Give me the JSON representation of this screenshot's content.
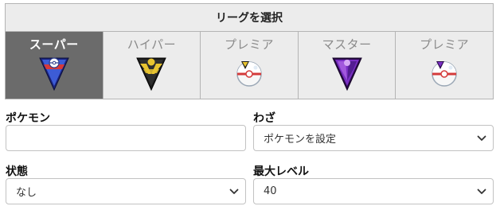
{
  "league": {
    "title": "リーグを選択",
    "tabs": [
      {
        "label": "スーパー",
        "icon": "super-league-icon",
        "selected": true
      },
      {
        "label": "ハイパー",
        "icon": "hyper-league-icon",
        "selected": false
      },
      {
        "label": "プレミア",
        "icon": "premier-ball-icon",
        "selected": false
      },
      {
        "label": "マスター",
        "icon": "master-league-icon",
        "selected": false
      },
      {
        "label": "プレミア",
        "icon": "premier-ball-master-icon",
        "selected": false
      }
    ]
  },
  "form": {
    "pokemon_label": "ポケモン",
    "pokemon_value": "",
    "move_label": "わざ",
    "move_value": "ポケモンを設定",
    "status_label": "状態",
    "status_value": "なし",
    "max_level_label": "最大レベル",
    "max_level_value": "40"
  },
  "colors": {
    "selected_tab_bg": "#6b6b6b",
    "tab_bg": "#ececec",
    "super_blue": "#3d5cd6",
    "hyper_gold": "#e8c430",
    "master_purple": "#7a2fc4"
  }
}
